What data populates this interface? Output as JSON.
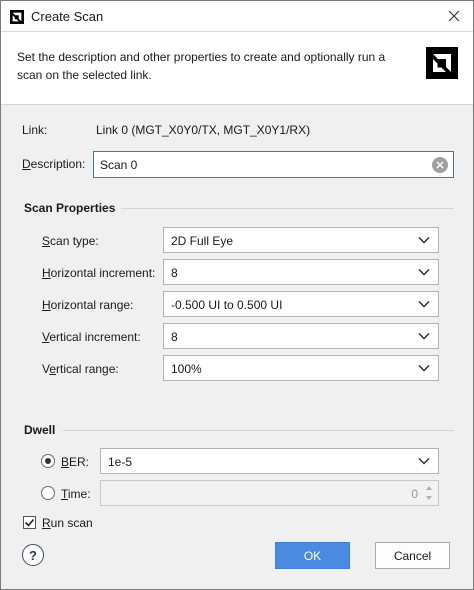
{
  "window": {
    "title": "Create Scan"
  },
  "header": {
    "description": "Set the description and other properties to create and optionally run a scan on the selected link."
  },
  "link": {
    "label": "Link:",
    "value": "Link 0 (MGT_X0Y0/TX, MGT_X0Y1/RX)"
  },
  "description": {
    "label_prefix": "",
    "label_mnemonic": "D",
    "label_rest": "escription:",
    "value": "Scan 0"
  },
  "scan_properties": {
    "title": "Scan Properties",
    "fields": [
      {
        "mnemonic": "S",
        "rest": "can type:",
        "value": "2D Full Eye"
      },
      {
        "mnemonic": "H",
        "rest": "orizontal increment:",
        "value": "8"
      },
      {
        "mnemonic": "H",
        "rest": "orizontal range:",
        "value": "-0.500 UI to 0.500 UI"
      },
      {
        "mnemonic": "V",
        "rest": "ertical increment:",
        "value": "8"
      },
      {
        "pre": "V",
        "mnemonic": "e",
        "rest": "rtical range:",
        "value": "100%"
      }
    ]
  },
  "dwell": {
    "title": "Dwell",
    "ber": {
      "mnemonic": "B",
      "rest": "ER:",
      "value": "1e-5",
      "selected": true
    },
    "time": {
      "mnemonic": "T",
      "rest": "ime:",
      "value": "0",
      "selected": false
    }
  },
  "run_scan": {
    "mnemonic": "R",
    "rest": "un scan",
    "checked": true
  },
  "buttons": {
    "help": "?",
    "ok": "OK",
    "cancel": "Cancel"
  },
  "colors": {
    "accent": "#4a8ae0",
    "focus_border": "#3c78c7",
    "dialog_bg": "#f0f0f0"
  },
  "icons": {
    "app": "amd-logo-icon",
    "close": "close-icon",
    "logo": "amd-logo-icon",
    "clear": "clear-input-icon",
    "dropdown": "chevron-down-icon",
    "spin_up": "spin-up-icon",
    "spin_down": "spin-down-icon",
    "check": "checkmark-icon"
  }
}
